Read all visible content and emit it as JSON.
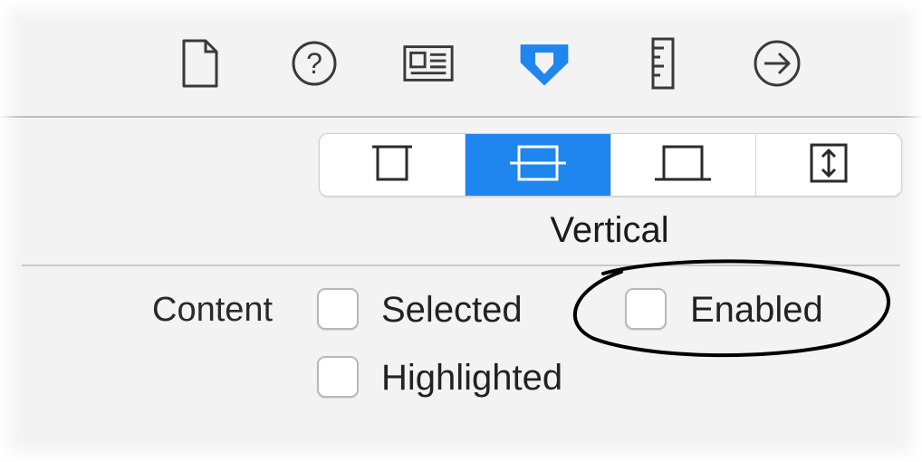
{
  "toolbar": {
    "icons": [
      {
        "name": "file-inspector-icon"
      },
      {
        "name": "quick-help-icon"
      },
      {
        "name": "identity-inspector-icon"
      },
      {
        "name": "attributes-inspector-icon",
        "active": true
      },
      {
        "name": "size-inspector-icon"
      },
      {
        "name": "connections-inspector-icon"
      }
    ],
    "active_color": "#1f86f0"
  },
  "alignment": {
    "segments": [
      {
        "name": "align-top-icon"
      },
      {
        "name": "align-center-icon",
        "selected": true
      },
      {
        "name": "align-bottom-icon"
      },
      {
        "name": "align-fill-icon"
      }
    ],
    "caption": "Vertical"
  },
  "content": {
    "label": "Content",
    "checkboxes": [
      {
        "label": "Selected",
        "checked": false
      },
      {
        "label": "Enabled",
        "checked": false
      },
      {
        "label": "Highlighted",
        "checked": false
      }
    ]
  }
}
